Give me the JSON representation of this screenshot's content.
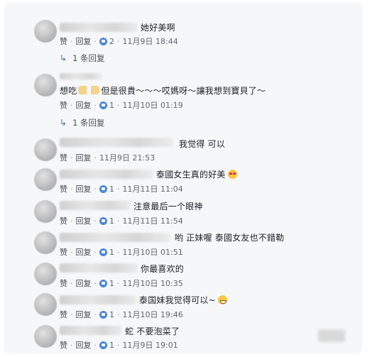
{
  "comments": [
    {
      "text": "她好美啊",
      "like_label": "赞",
      "reply_label": "回复",
      "reactions": "2",
      "time": "11月9日 18:44",
      "replies_label": "1 条回复"
    },
    {
      "text_a": "想吃",
      "text_b": "但是很貴～～～哎媽呀～讓我想到寶貝了～",
      "like_label": "赞",
      "reply_label": "回复",
      "reactions": "1",
      "time": "11月10日 01:19",
      "replies_label": "1 条回复"
    },
    {
      "text": "我觉得 可以",
      "like_label": "赞",
      "reply_label": "回复",
      "time": "11月9日 21:53"
    },
    {
      "text": "泰國女生真的好美",
      "like_label": "赞",
      "reply_label": "回复",
      "reactions": "1",
      "time": "11月11日 11:04",
      "emoji": "heart-eyes-emoji"
    },
    {
      "text": "注意最后一个眼神",
      "like_label": "赞",
      "reply_label": "回复",
      "reactions": "1",
      "time": "11月11日 11:54"
    },
    {
      "text": "哟 正妹喔 泰國女友也不錯勒",
      "like_label": "赞",
      "reply_label": "回复",
      "reactions": "1",
      "time": "11月10日 01:51"
    },
    {
      "text": "你最喜欢的",
      "like_label": "赞",
      "reply_label": "回复",
      "reactions": "1",
      "time": "11月10日 10:35"
    },
    {
      "text": "泰国妹我觉得可以~",
      "like_label": "赞",
      "reply_label": "回复",
      "reactions": "1",
      "time": "11月10日 19:46",
      "emoji": "grin-emoji"
    },
    {
      "text": "蛇 不要泡菜了",
      "like_label": "赞",
      "reply_label": "回复",
      "reactions": "1",
      "time": "11月9日 19:01"
    }
  ],
  "colors": {
    "background": "#f6f7f9",
    "text": "#1d2129",
    "meta": "#606770",
    "like_badge": "#4c86d9"
  }
}
